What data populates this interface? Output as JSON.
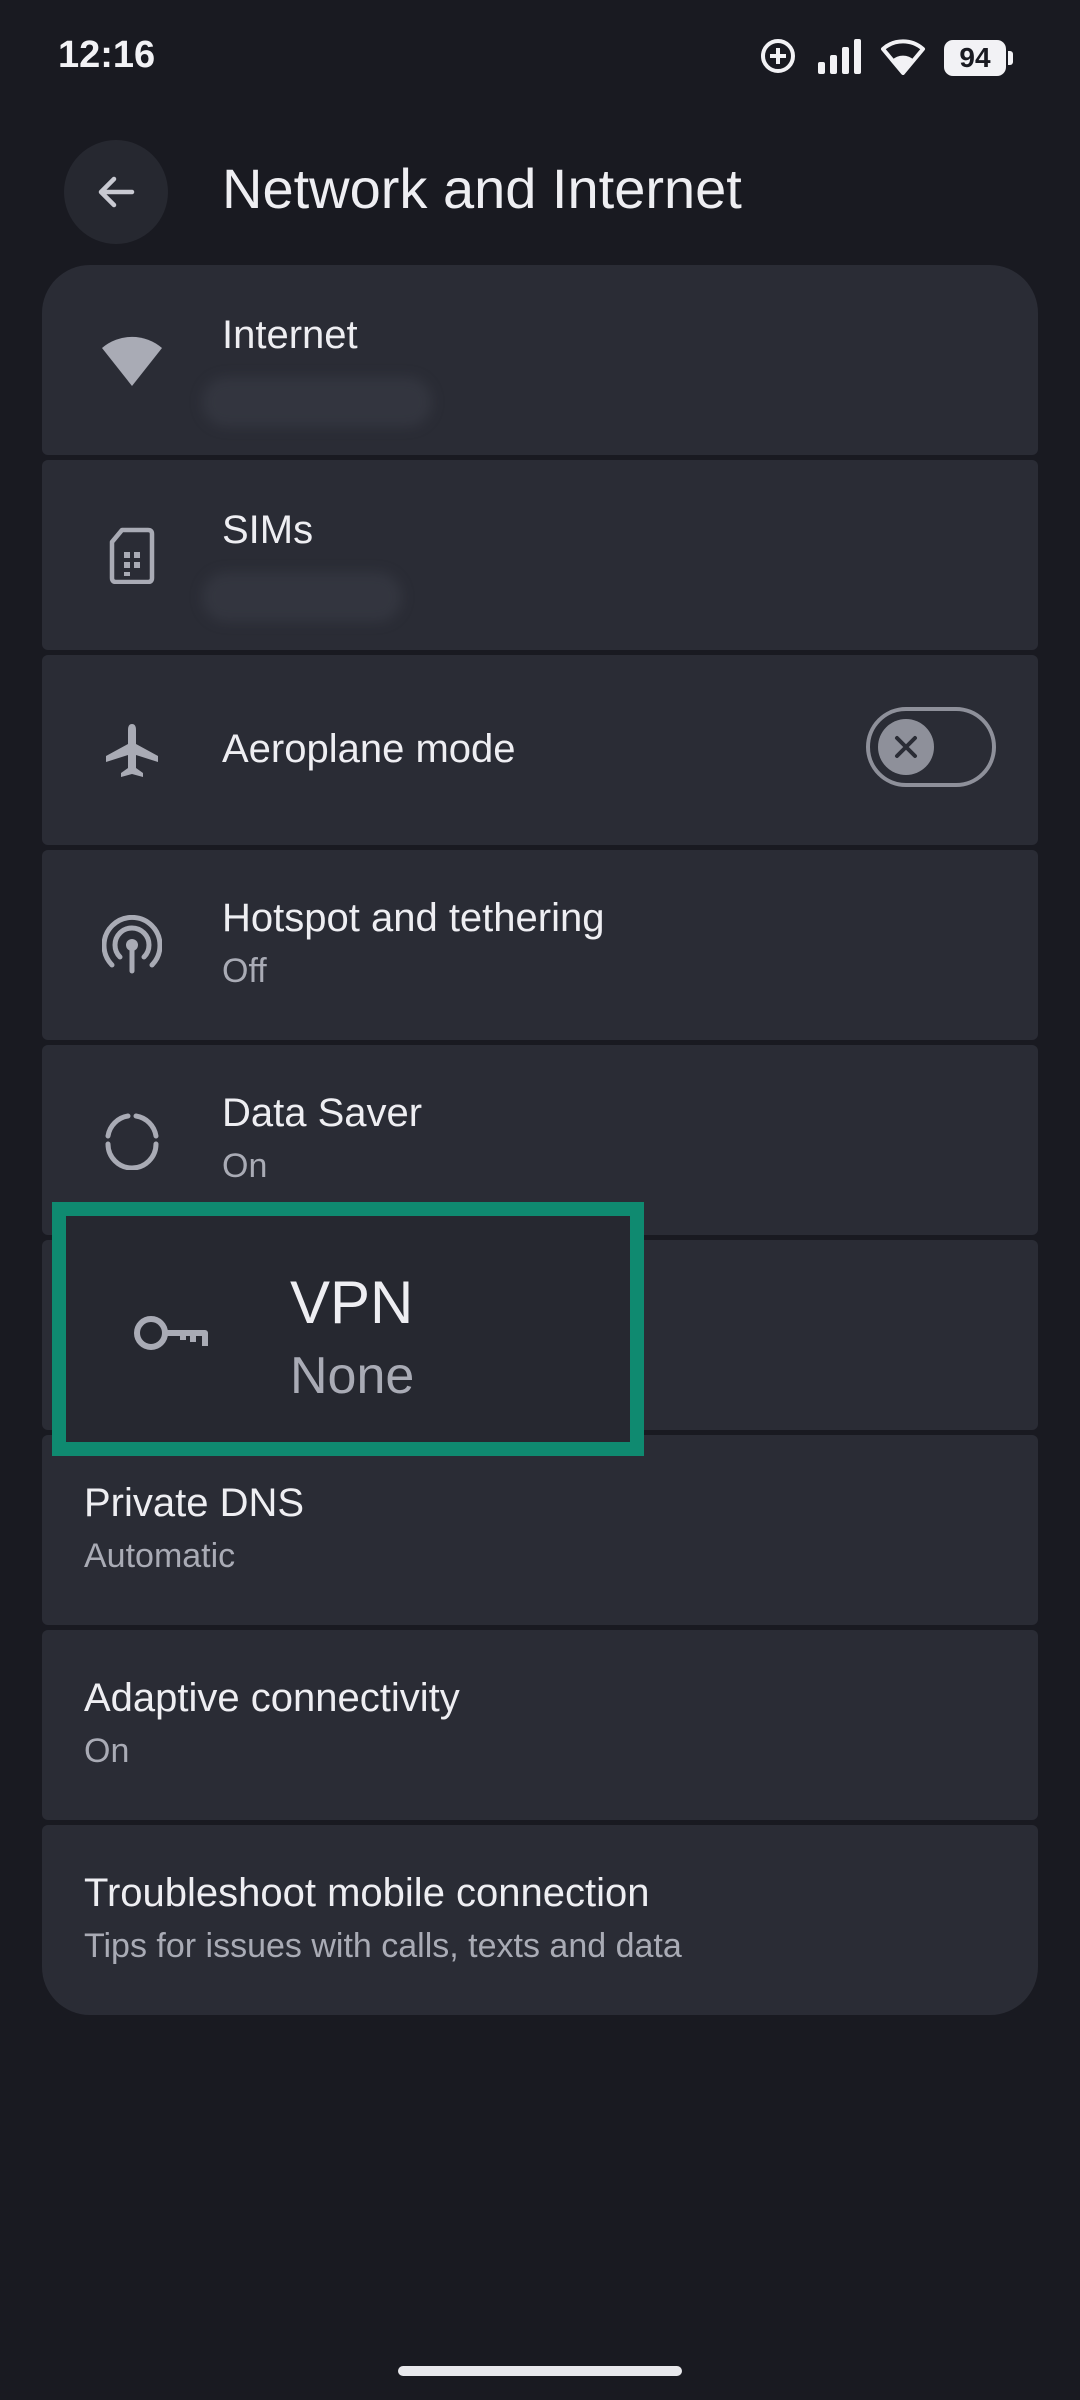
{
  "status_bar": {
    "time": "12:16",
    "battery": "94",
    "icons": [
      "data-saver-icon",
      "signal-icon",
      "wifi-icon",
      "battery-icon"
    ]
  },
  "header": {
    "title": "Network and Internet",
    "back_icon": "arrow-back-icon"
  },
  "items": [
    {
      "title": "Internet",
      "icon": "wifi-icon"
    },
    {
      "title": "SIMs",
      "icon": "sim-card-icon"
    },
    {
      "title": "Aeroplane mode",
      "icon": "airplane-icon",
      "toggle_on": false
    },
    {
      "title": "Hotspot and tethering",
      "subtitle": "Off",
      "icon": "hotspot-icon"
    },
    {
      "title": "Data Saver",
      "subtitle": "On",
      "icon": "data-saver-icon"
    },
    {
      "title": "VPN",
      "subtitle": "None",
      "icon": "key-icon"
    },
    {
      "title": "Private DNS",
      "subtitle": "Automatic"
    },
    {
      "title": "Adaptive connectivity",
      "subtitle": "On"
    },
    {
      "title": "Troubleshoot mobile connection",
      "subtitle": "Tips for issues with calls, texts and data"
    }
  ],
  "colors": {
    "background": "#191a21",
    "card": "#2a2c35",
    "highlight_border": "#0f8a70",
    "secondary_text": "#a9abb5"
  }
}
